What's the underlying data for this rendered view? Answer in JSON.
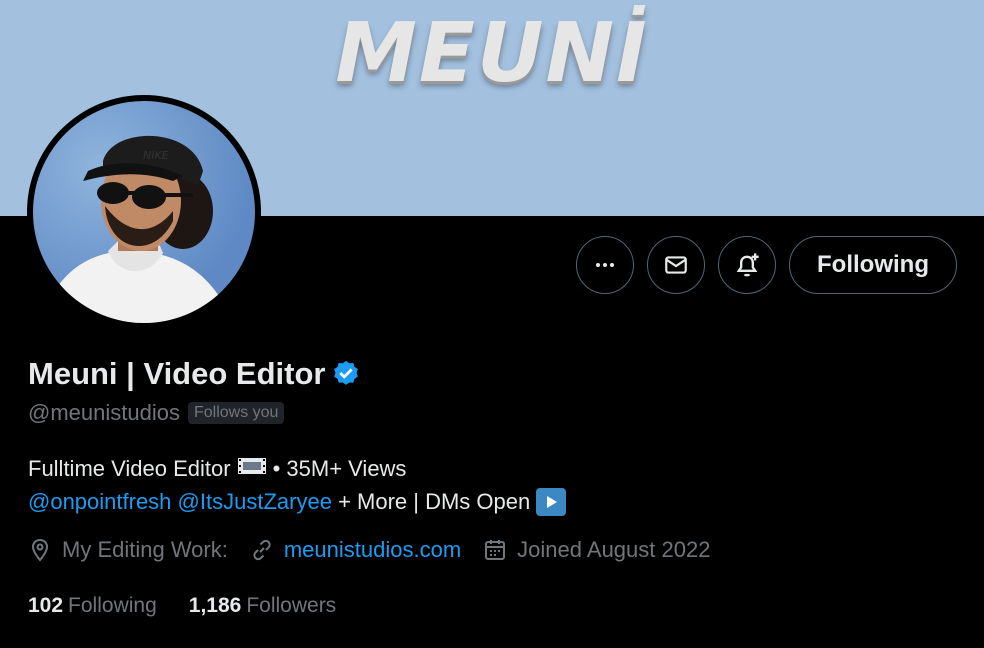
{
  "banner": {
    "text": "MEUNİ"
  },
  "profile": {
    "name": "Meuni | Video Editor",
    "handle": "@meunistudios",
    "follows_you": "Follows you"
  },
  "actions": {
    "more_icon": "more-horizontal-icon",
    "message_icon": "envelope-icon",
    "notify_icon": "bell-plus-icon",
    "following_label": "Following"
  },
  "bio": {
    "line1_a": "Fulltime Video Editor",
    "line1_b": "• 35M+ Views",
    "mention1": "@onpointfresh",
    "mention2": "@ItsJustZaryee",
    "line2_rest": "+ More | DMs Open"
  },
  "meta": {
    "location": "My Editing Work:",
    "website": "meunistudios.com",
    "joined": "Joined August 2022"
  },
  "stats": {
    "following_count": "102",
    "following_label": "Following",
    "followers_count": "1,186",
    "followers_label": "Followers"
  },
  "colors": {
    "accent": "#1d9bf0",
    "banner": "#a3c0df",
    "muted": "#71767b"
  }
}
